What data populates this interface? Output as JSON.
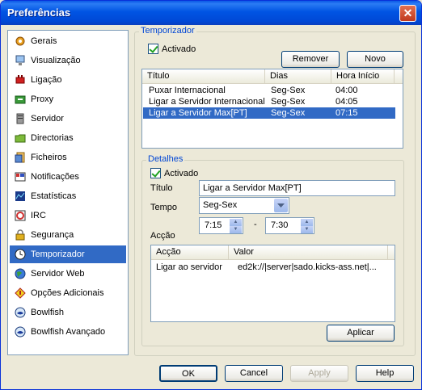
{
  "window": {
    "title": "Preferências"
  },
  "sidebar": {
    "items": [
      {
        "label": "Gerais",
        "icon": "gear-icon"
      },
      {
        "label": "Visualização",
        "icon": "monitor-icon"
      },
      {
        "label": "Ligação",
        "icon": "connection-plug-icon"
      },
      {
        "label": "Proxy",
        "icon": "proxy-icon"
      },
      {
        "label": "Servidor",
        "icon": "server-icon"
      },
      {
        "label": "Directorias",
        "icon": "folder-icon"
      },
      {
        "label": "Ficheiros",
        "icon": "file-icon"
      },
      {
        "label": "Notificações",
        "icon": "notification-icon"
      },
      {
        "label": "Estatísticas",
        "icon": "statistics-icon"
      },
      {
        "label": "IRC",
        "icon": "irc-icon"
      },
      {
        "label": "Segurança",
        "icon": "lock-icon"
      },
      {
        "label": "Temporizador",
        "icon": "clock-icon",
        "selected": true
      },
      {
        "label": "Servidor Web",
        "icon": "globe-icon"
      },
      {
        "label": "Opções Adicionais",
        "icon": "warning-icon"
      },
      {
        "label": "Bowlfish",
        "icon": "bowlfish-icon"
      },
      {
        "label": "Bowlfish Avançado",
        "icon": "bowlfish-advanced-icon"
      }
    ]
  },
  "scheduler": {
    "group_label": "Temporizador",
    "enabled_label": "Activado",
    "remove_button": "Remover",
    "new_button": "Novo",
    "columns": [
      "Título",
      "Dias",
      "Hora Início"
    ],
    "rows": [
      {
        "title": "Puxar Internacional",
        "days": "Seg-Sex",
        "start": "04:00"
      },
      {
        "title": "Ligar a Servidor Internacional",
        "days": "Seg-Sex",
        "start": "04:05"
      },
      {
        "title": "Ligar a Servidor Max[PT]",
        "days": "Seg-Sex",
        "start": "07:15",
        "selected": true
      }
    ]
  },
  "details": {
    "group_label": "Detalhes",
    "enabled_label": "Activado",
    "title_label": "Título",
    "title_value": "Ligar a Servidor Max[PT]",
    "time_label": "Tempo",
    "time_value": "Seg-Sex",
    "start_time": "7:15",
    "separator": "-",
    "end_time": "7:30",
    "action_label": "Acção",
    "action_columns": [
      "Acção",
      "Valor"
    ],
    "actions": [
      {
        "action": "Ligar ao servidor",
        "value": "ed2k://|server|sado.kicks-ass.net|..."
      }
    ],
    "apply_button": "Aplicar"
  },
  "footer": {
    "ok": "OK",
    "cancel": "Cancel",
    "apply": "Apply",
    "help": "Help"
  },
  "colors": {
    "selection": "#316AC5",
    "titlebar": "#0054E3",
    "group_label": "#0046D5"
  }
}
